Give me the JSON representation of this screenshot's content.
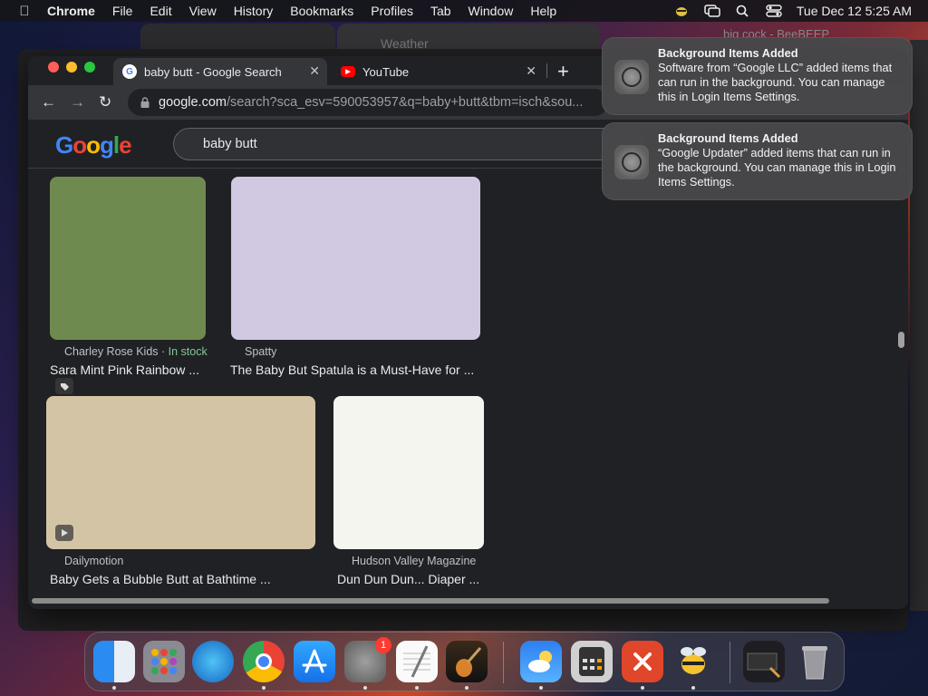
{
  "menubar": {
    "app_name": "Chrome",
    "items": [
      "File",
      "Edit",
      "View",
      "History",
      "Bookmarks",
      "Profiles",
      "Tab",
      "Window",
      "Help"
    ],
    "clock": "Tue Dec 12  5:25 AM"
  },
  "background_windows": {
    "weather_title": "Weather",
    "bee_title": "big cock - BeeBEEP"
  },
  "browser": {
    "tabs": [
      {
        "title": "baby butt - Google Search",
        "active": true,
        "favicon": "google-icon"
      },
      {
        "title": "YouTube",
        "active": false,
        "favicon": "youtube-icon"
      }
    ],
    "url_host": "google.com",
    "url_rest": "/search?sca_esv=590053957&q=baby+butt&tbm=isch&sou...",
    "search_query": "baby butt",
    "logo_text": "Google"
  },
  "results": [
    {
      "source": "Charley Rose Kids",
      "stock": "In stock",
      "title": "Sara Mint Pink Rainbow ...",
      "color": "#6f8a4f",
      "badge": "tag-icon"
    },
    {
      "source": "Spatty",
      "stock": "",
      "title": "The Baby But Spatula is a Must-Have for ...",
      "color": "#d1c8e2",
      "badge": ""
    },
    {
      "source": "Dailymotion",
      "stock": "",
      "title": "Baby Gets a Bubble Butt at Bathtime ...",
      "color": "#d4c4a6",
      "badge": "play-icon"
    },
    {
      "source": "Hudson Valley Magazine",
      "stock": "",
      "title": "Dun Dun Dun... Diaper ...",
      "color": "#f5f5ef",
      "badge": ""
    }
  ],
  "notifications": [
    {
      "title": "Background Items Added",
      "body": "Software from “Google LLC” added items that can run in the background. You can manage this in Login Items Settings."
    },
    {
      "title": "Background Items Added",
      "body": "“Google Updater” added items that can run in the background. You can manage this in Login Items Settings."
    }
  ],
  "dock": {
    "apps": [
      "Finder",
      "Launchpad",
      "Safari",
      "Chrome",
      "App Store",
      "System Settings",
      "TextEdit",
      "GarageBand",
      "Weather",
      "Calculator",
      "Remote Desktop",
      "BeeBEEP",
      "Screenshot",
      "Trash"
    ],
    "settings_badge": "1"
  },
  "colors": {
    "tab_active": "#35363a",
    "page_bg": "#202124",
    "in_stock": "#81c995"
  }
}
